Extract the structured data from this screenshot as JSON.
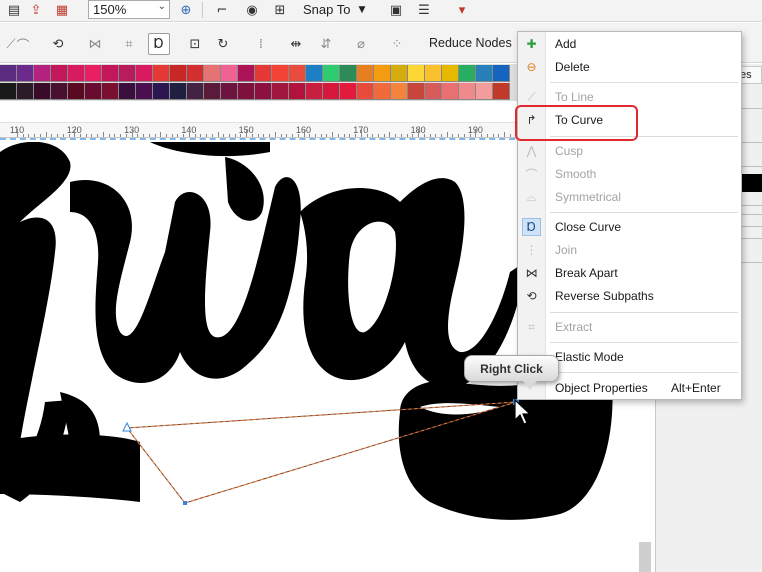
{
  "toolbar": {
    "zoom_value": "150%",
    "snap_to_label": "Snap To",
    "icons": [
      "save-icon",
      "export-icon",
      "pdf-icon",
      "zoom-combo",
      "fit-icon",
      "rulers-icon",
      "view-icon",
      "wireframe-icon",
      "snap-to",
      "options-icon",
      "settings-icon",
      "launch-icon"
    ]
  },
  "property_bar": {
    "reduce_nodes_label": "Reduce Nodes",
    "active_icon": "close-curve-icon"
  },
  "palette": {
    "row1": [
      "#5a2d82",
      "#6c2a8c",
      "#b5217e",
      "#c2185b",
      "#d81b60",
      "#e91e63",
      "#c2185b",
      "#b71c5c",
      "#d81b60",
      "#e53935",
      "#c62828",
      "#d32f2f",
      "#e57373",
      "#f06292",
      "#ad1457",
      "#e53935",
      "#f44336",
      "#e74c3c",
      "#1e7fc4",
      "#2ecc71",
      "#2e8b57",
      "#e67e22",
      "#f39c12",
      "#d4ac0d",
      "#fdd835",
      "#fbc02d",
      "#e6b800",
      "#27ae60",
      "#2980b9",
      "#1565c0"
    ],
    "row2": [
      "#1a1a1a",
      "#2a1a2a",
      "#3a0a2a",
      "#4a1030",
      "#5a0a20",
      "#6a0a30",
      "#7a1030",
      "#3a0f3f",
      "#4a0f4f",
      "#2b1650",
      "#1f1f3f",
      "#442244",
      "#5a1a3a",
      "#6e1340",
      "#7d103d",
      "#8c1040",
      "#a0163f",
      "#b3123c",
      "#c71f3f",
      "#d6183c",
      "#e21b3c",
      "#e84a3c",
      "#f06a3c",
      "#f4843c",
      "#c8453c",
      "#d85b5b",
      "#e97070",
      "#f08a8a",
      "#f39c9c",
      "#c0392b"
    ]
  },
  "ruler": {
    "labels": [
      "110",
      "120",
      "130",
      "140",
      "150",
      "160",
      "170",
      "180",
      "190"
    ]
  },
  "dock": {
    "tab_label": "es"
  },
  "context_menu": {
    "items": [
      {
        "label": "Add",
        "icon": "add-node-icon",
        "enabled": true,
        "shortcut": ""
      },
      {
        "label": "Delete",
        "icon": "delete-node-icon",
        "enabled": true,
        "shortcut": ""
      },
      {
        "label": "To Line",
        "icon": "to-line-icon",
        "enabled": false,
        "shortcut": ""
      },
      {
        "label": "To Curve",
        "icon": "to-curve-icon",
        "enabled": true,
        "shortcut": ""
      },
      {
        "label": "Cusp",
        "icon": "cusp-icon",
        "enabled": false,
        "shortcut": ""
      },
      {
        "label": "Smooth",
        "icon": "smooth-icon",
        "enabled": false,
        "shortcut": ""
      },
      {
        "label": "Symmetrical",
        "icon": "symmetrical-icon",
        "enabled": false,
        "shortcut": ""
      },
      {
        "label": "Close Curve",
        "icon": "close-curve-icon",
        "enabled": true,
        "shortcut": ""
      },
      {
        "label": "Join",
        "icon": "join-icon",
        "enabled": false,
        "shortcut": ""
      },
      {
        "label": "Break Apart",
        "icon": "break-apart-icon",
        "enabled": true,
        "shortcut": ""
      },
      {
        "label": "Reverse Subpaths",
        "icon": "reverse-subpaths-icon",
        "enabled": true,
        "shortcut": ""
      },
      {
        "label": "Extract",
        "icon": "extract-icon",
        "enabled": false,
        "shortcut": ""
      },
      {
        "label": "Elastic Mode",
        "icon": "elastic-mode-icon",
        "enabled": true,
        "shortcut": ""
      },
      {
        "label": "Object Properties",
        "icon": "object-properties-icon",
        "enabled": true,
        "shortcut": "Alt+Enter"
      }
    ],
    "highlighted_item": "To Curve"
  },
  "tooltip": {
    "text": "Right Click"
  },
  "colors": {
    "highlight_border": "#e0282e",
    "guide_blue": "#2e86de",
    "path_line": "#c0692a"
  }
}
